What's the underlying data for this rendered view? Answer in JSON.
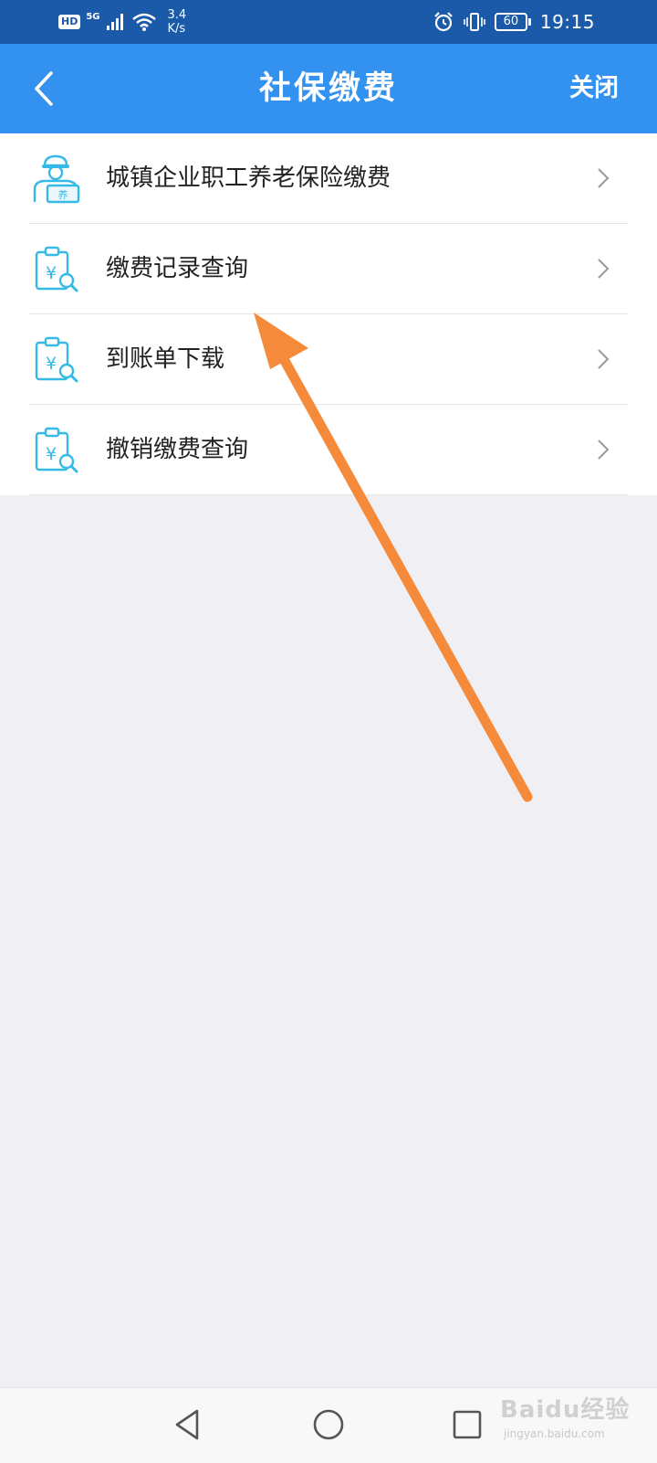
{
  "status_bar": {
    "hd": "HD",
    "network": "5G",
    "speed_value": "3.4",
    "speed_unit": "K/s",
    "battery": "60",
    "time": "19:15"
  },
  "nav": {
    "title": "社保缴费",
    "close_label": "关闭"
  },
  "menu": {
    "items": [
      {
        "label": "城镇企业职工养老保险缴费",
        "icon": "pension-worker-icon"
      },
      {
        "label": "缴费记录查询",
        "icon": "payment-receipt-icon"
      },
      {
        "label": "到账单下载",
        "icon": "payment-receipt-icon"
      },
      {
        "label": "撤销缴费查询",
        "icon": "payment-receipt-icon"
      }
    ]
  },
  "watermark": {
    "logo": "Baidu经验",
    "url": "jingyan.baidu.com"
  },
  "colors": {
    "status_bar": "#1a5aa8",
    "nav_bar": "#3391ef",
    "icon_accent": "#35b9e6",
    "annotation_arrow": "#f58a3a",
    "page_background": "#efeff4"
  }
}
